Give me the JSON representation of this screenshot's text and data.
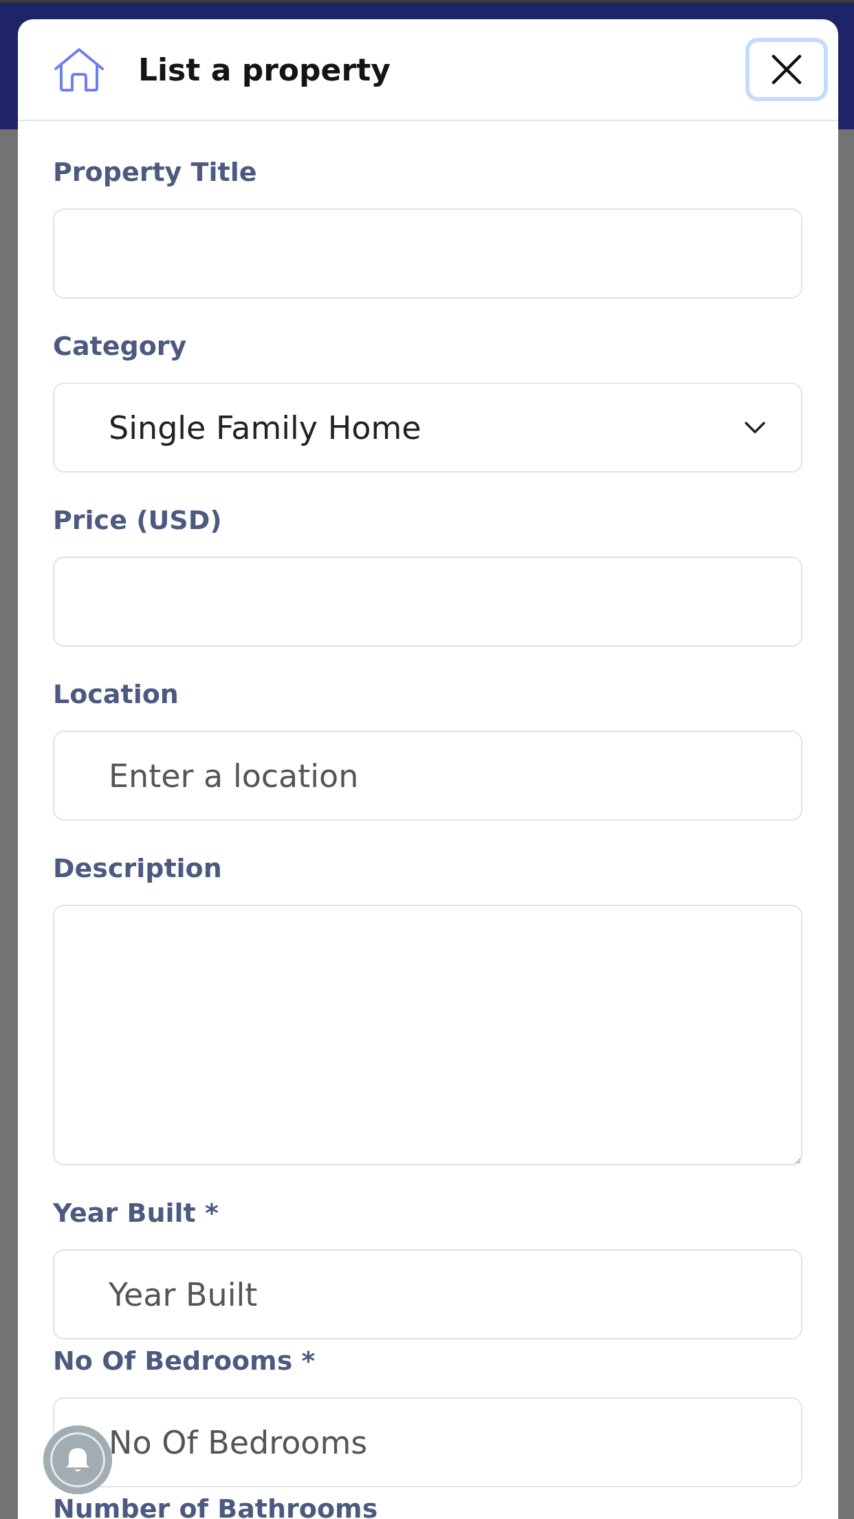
{
  "header": {
    "title": "List a property",
    "close_button": {
      "focused": true
    }
  },
  "fields": [
    {
      "kind": "text",
      "label": "Property Title"
    },
    {
      "kind": "select",
      "label": "Category",
      "value": "Single Family Home"
    },
    {
      "kind": "text",
      "label": "Price (USD)"
    },
    {
      "kind": "text",
      "label": "Location",
      "placeholder": "Enter a location"
    },
    {
      "kind": "textarea",
      "label": "Description"
    },
    {
      "kind": "number",
      "label": "Year Built *",
      "placeholder": "Year Built"
    },
    {
      "kind": "number",
      "label": "No Of Bedrooms *",
      "placeholder": "No Of Bedrooms"
    },
    {
      "kind": "label",
      "label": "Number of Bathrooms"
    }
  ]
}
